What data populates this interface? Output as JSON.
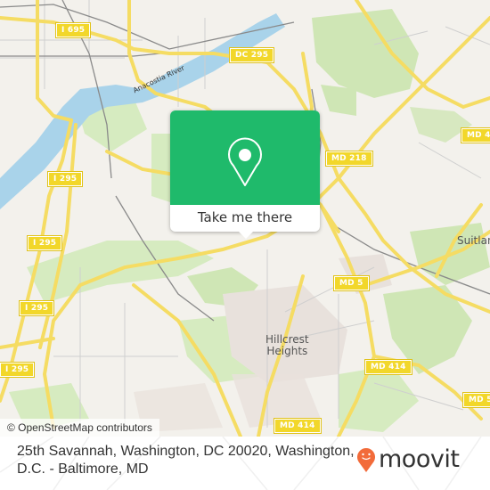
{
  "map": {
    "attribution": "© OpenStreetMap contributors",
    "colors": {
      "land": "#f3f1ec",
      "water": "#a9d3ea",
      "park": "#cfe6b5",
      "urban": "#e8e1dc",
      "road_major": "#f5dc63",
      "road_minor": "#c8c8c8",
      "rail": "#8a8a8a"
    },
    "road_shields": [
      {
        "id": "i695",
        "label": "I 695"
      },
      {
        "id": "dc295",
        "label": "DC 295"
      },
      {
        "id": "md4",
        "label": "MD 4"
      },
      {
        "id": "md218",
        "label": "MD 218"
      },
      {
        "id": "i295a",
        "label": "I 295"
      },
      {
        "id": "i295b",
        "label": "I 295"
      },
      {
        "id": "i295c",
        "label": "I 295"
      },
      {
        "id": "i295d",
        "label": "I 295"
      },
      {
        "id": "i295e",
        "label": "295"
      },
      {
        "id": "md5a",
        "label": "MD 5"
      },
      {
        "id": "md414a",
        "label": "MD 414"
      },
      {
        "id": "md5b",
        "label": "MD 5"
      },
      {
        "id": "md414b",
        "label": "MD 414"
      }
    ],
    "place_labels": {
      "suitland": "Suitland",
      "hillcrest": "Hillcrest\nHeights",
      "river": "Anacostia River"
    }
  },
  "popup": {
    "button_label": "Take me there",
    "accent": "#1fba6b",
    "icon": "map-pin-icon"
  },
  "footer": {
    "address": "25th Savannah, Washington, DC 20020, Washington, D.C. - Baltimore, MD",
    "brand": "moovit",
    "brand_color": "#f26b3a"
  }
}
